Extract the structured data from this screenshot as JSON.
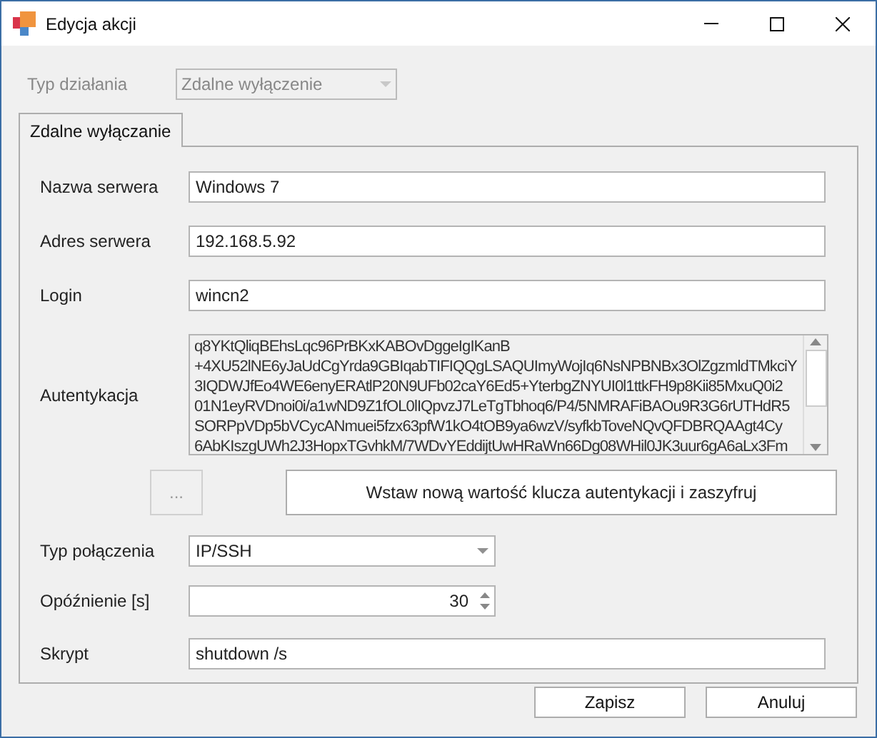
{
  "window": {
    "title": "Edycja akcji"
  },
  "action_type": {
    "label": "Typ działania",
    "value": "Zdalne wyłączenie",
    "disabled": true
  },
  "tabs": [
    {
      "label": "Zdalne wyłączanie",
      "selected": true
    }
  ],
  "fields": [
    {
      "kind": "text",
      "label": "Nazwa serwera",
      "value": "Windows 7"
    },
    {
      "kind": "text",
      "label": "Adres serwera",
      "value": "192.168.5.92"
    },
    {
      "kind": "text",
      "label": "Login",
      "value": "wincn2"
    },
    {
      "kind": "memo",
      "label": "Autentykacja",
      "lines": [
        "q8YKtQliqBEhsLqc96PrBKxKABOvDggeIgIKanB",
        "+4XU52lNE6yJaUdCgYrda9GBIqabTIFIQQgLSAQUImyWojIq6NsNPBNBx3OlZgzmldTMkciY",
        "3IQDWJfEo4WE6enyERAtlP20N9UFb02caY6Ed5+YterbgZNYUI0l1ttkFH9p8Kii85MxuQ0i2",
        "01N1eyRVDnoi0i/a1wND9Z1fOL0lIQpvzJ7LeTgTbhoq6/P4/5NMRAFiBAOu9R3G6rUTHdR5",
        "SORPpVDp5bVCycANmuei5fzx63pfW1kO4tOB9ya6wzV/syfkbToveNQvQFDBRQAAgt4Cy",
        "6AbKIszgUWh2J3HopxTGvhkM/7WDvYEddijtUwHRaWn66Dg08WHil0JK3uur6gA6aLx3Fm"
      ],
      "disabled": true
    },
    {
      "kind": "buttons",
      "small": {
        "label": "...",
        "disabled": true
      },
      "wide": {
        "label": "Wstaw nową wartość klucza autentykacji i zaszyfruj"
      }
    },
    {
      "kind": "combo",
      "label": "Typ połączenia",
      "value": "IP/SSH"
    },
    {
      "kind": "spin",
      "label": "Opóźnienie [s]",
      "value": "30"
    },
    {
      "kind": "text",
      "label": "Skrypt",
      "value": "shutdown /s"
    }
  ],
  "buttons": [
    "Zapisz",
    "Anuluj"
  ]
}
